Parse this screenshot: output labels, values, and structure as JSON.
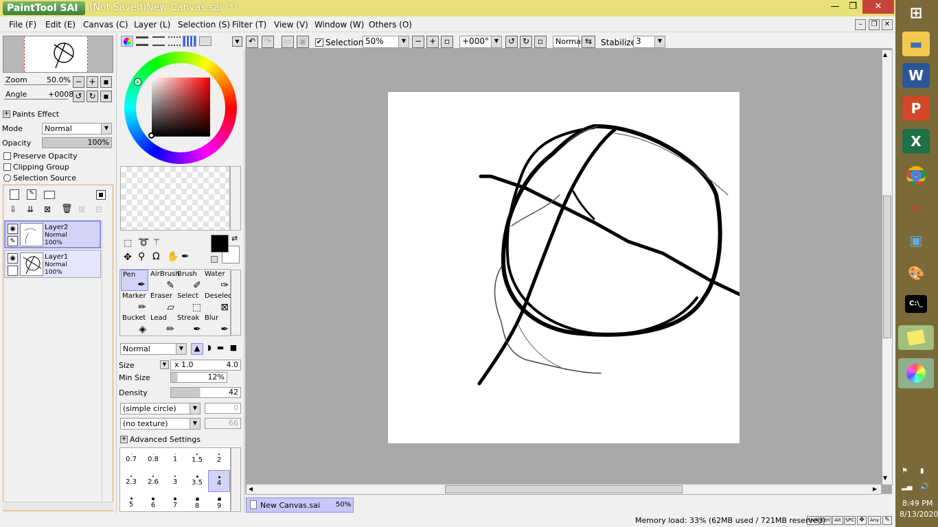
{
  "window": {
    "app_logo": "PaintTool SAI",
    "title": "(Not Saved)New Canvas.sai (*)",
    "minimize": "—",
    "restore": "❐",
    "close": "✕"
  },
  "menu": [
    "File (F)",
    "Edit (E)",
    "Canvas (C)",
    "Layer (L)",
    "Selection (S)",
    "Filter (T)",
    "View (V)",
    "Window (W)",
    "Others (O)"
  ],
  "navigator": {
    "zoom_label": "Zoom",
    "zoom_value": "50.0%",
    "angle_label": "Angle",
    "angle_value": "+0008"
  },
  "paints_effect": {
    "header": "Paints Effect",
    "mode_label": "Mode",
    "mode_value": "Normal",
    "opacity_label": "Opacity",
    "opacity_value": "100%",
    "preserve_opacity": "Preserve Opacity",
    "clipping_group": "Clipping Group",
    "selection_source": "Selection Source"
  },
  "layers": [
    {
      "name": "Layer2",
      "mode": "Normal",
      "opacity": "100%",
      "selected": true
    },
    {
      "name": "Layer1",
      "mode": "Normal",
      "opacity": "100%",
      "selected": false
    }
  ],
  "tools": [
    {
      "label": "Pen",
      "selected": true
    },
    {
      "label": "AirBrush"
    },
    {
      "label": "Brush"
    },
    {
      "label": "Water"
    },
    {
      "label": "Marker"
    },
    {
      "label": "Eraser"
    },
    {
      "label": "Select"
    },
    {
      "label": "Deselect"
    },
    {
      "label": "Bucket"
    },
    {
      "label": "Lead"
    },
    {
      "label": "Streak"
    },
    {
      "label": "Blur"
    }
  ],
  "brush": {
    "blend_mode": "Normal",
    "size_label": "Size",
    "size_mult": "x 1.0",
    "size_value": "4.0",
    "min_size_label": "Min Size",
    "min_size_value": "12%",
    "density_label": "Density",
    "density_value": "42",
    "shape": "(simple circle)",
    "shape_value": "0",
    "texture": "(no texture)",
    "texture_value": "66",
    "advanced": "Advanced Settings"
  },
  "brush_sizes": [
    [
      "0.7",
      "0.8",
      "1",
      "1.5",
      "2"
    ],
    [
      "2.3",
      "2.6",
      "3",
      "3.5",
      "4"
    ],
    [
      "5",
      "6",
      "7",
      "8",
      "9"
    ]
  ],
  "toolbar": {
    "selection_label": "Selection",
    "zoom_value": "50%",
    "rotation_value": "+000°",
    "blend": "Normal",
    "stabilizer_label": "Stabilizer",
    "stabilizer_value": "3"
  },
  "document_tab": {
    "name": "New Canvas.sai",
    "zoom": "50%"
  },
  "status": {
    "memory": "Memory load: 33% (62MB used / 721MB reserved)",
    "keys": [
      "Shift",
      "Ctrl",
      "Alt",
      "SPC",
      "Any"
    ]
  },
  "taskbar": {
    "time": "8:49 PM",
    "date": "8/13/2020",
    "icons": [
      "windows-start",
      "file-explorer",
      "word",
      "powerpoint",
      "excel",
      "chrome",
      "snipping-tool",
      "remote-desktop",
      "paint",
      "cmd",
      "sticky-notes",
      "painttool-sai"
    ]
  }
}
